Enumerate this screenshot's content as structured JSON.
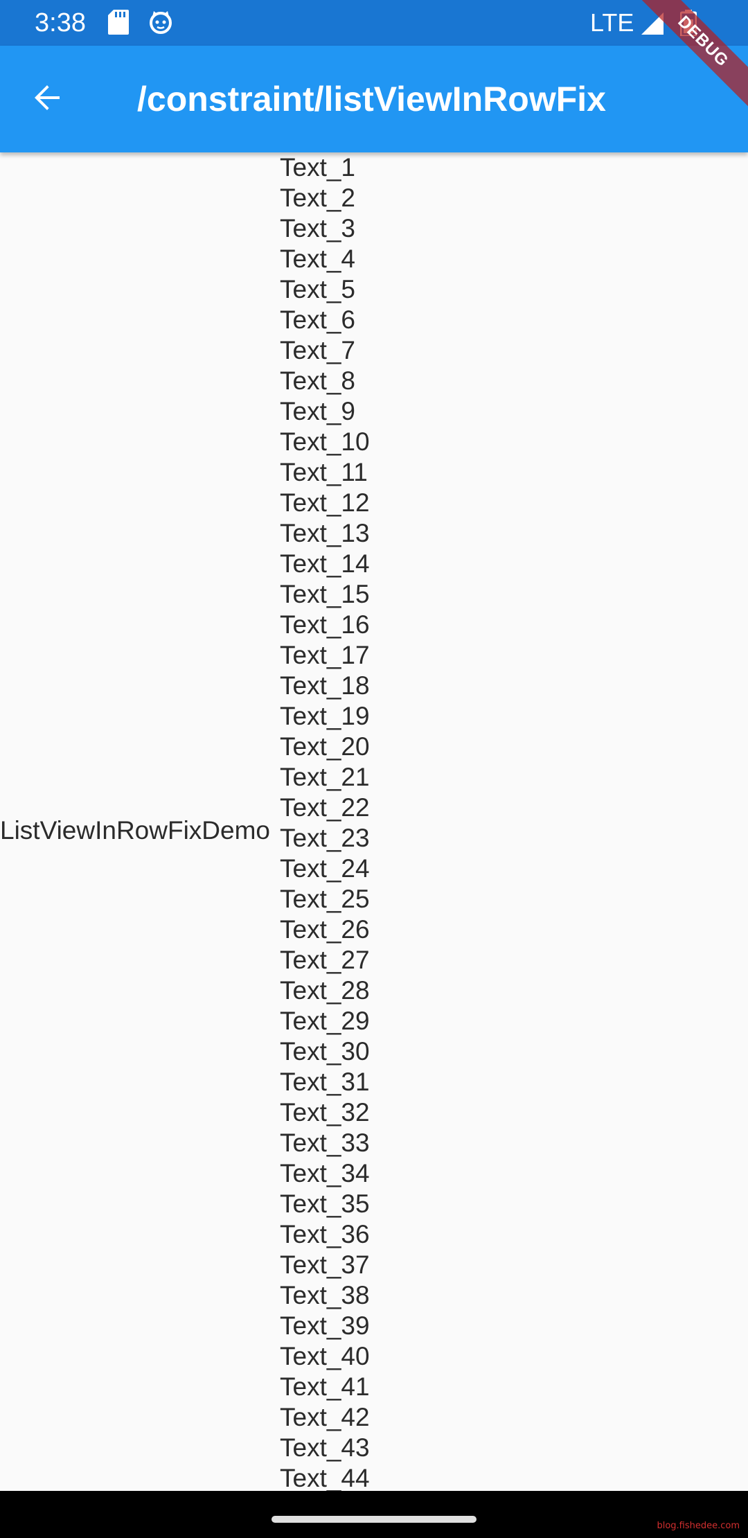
{
  "status_bar": {
    "time": "3:38",
    "network": "LTE",
    "icons": [
      "sd-card-icon",
      "cat-face-icon",
      "signal-icon",
      "battery-icon"
    ]
  },
  "app_bar": {
    "title": "/constraint/listViewInRowFix",
    "back_icon": "arrow-left-icon"
  },
  "debug_banner": "DEBUG",
  "row": {
    "left_label": "ListViewInRowFixDemo",
    "items": [
      "Text_1",
      "Text_2",
      "Text_3",
      "Text_4",
      "Text_5",
      "Text_6",
      "Text_7",
      "Text_8",
      "Text_9",
      "Text_10",
      "Text_11",
      "Text_12",
      "Text_13",
      "Text_14",
      "Text_15",
      "Text_16",
      "Text_17",
      "Text_18",
      "Text_19",
      "Text_20",
      "Text_21",
      "Text_22",
      "Text_23",
      "Text_24",
      "Text_25",
      "Text_26",
      "Text_27",
      "Text_28",
      "Text_29",
      "Text_30",
      "Text_31",
      "Text_32",
      "Text_33",
      "Text_34",
      "Text_35",
      "Text_36",
      "Text_37",
      "Text_38",
      "Text_39",
      "Text_40",
      "Text_41",
      "Text_42",
      "Text_43",
      "Text_44"
    ]
  },
  "watermark": "blog.fishedee.com",
  "colors": {
    "status_bar": "#1976d2",
    "app_bar": "#2196f3",
    "background": "#fafafa",
    "debug_banner": "#b71c1c"
  }
}
